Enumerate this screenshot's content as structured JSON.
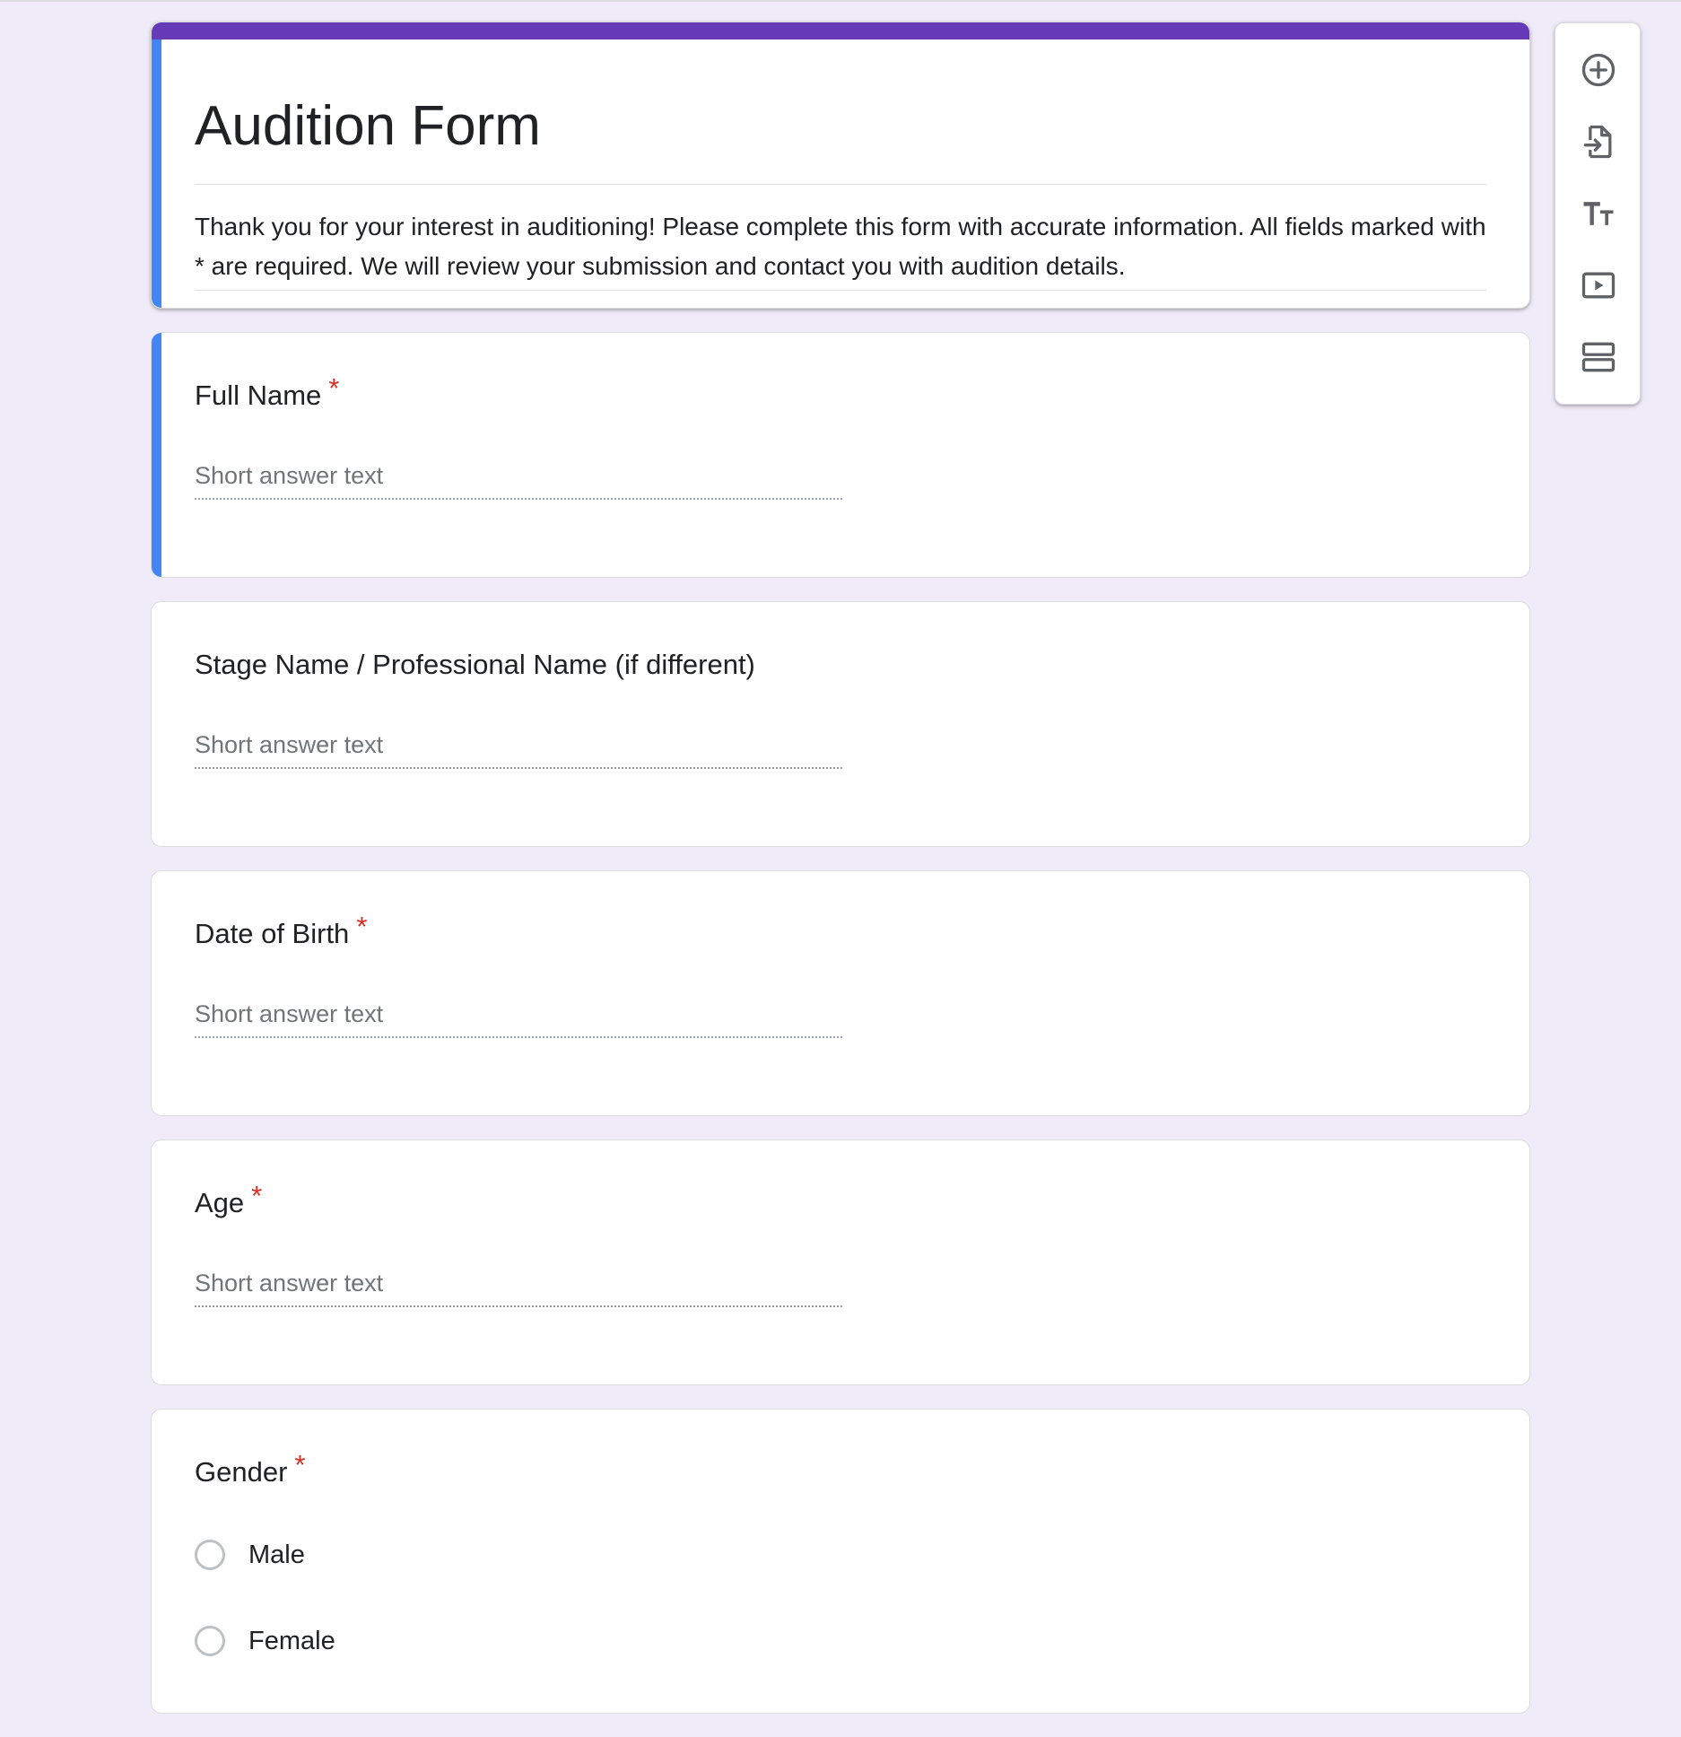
{
  "colors": {
    "page_background": "#f0ebf8",
    "accent_purple": "#673ab7",
    "active_blue": "#4285f4",
    "required_red": "#d93025"
  },
  "form": {
    "title": "Audition Form",
    "description": "Thank you for your interest in auditioning! Please complete this form with accurate information. All fields marked with * are required. We will review your submission and contact you with audition details."
  },
  "questions": [
    {
      "title": "Full Name",
      "required": "*",
      "placeholder": "Short answer text"
    },
    {
      "title": "Stage Name / Professional Name (if different)",
      "placeholder": "Short answer text"
    },
    {
      "title": "Date of Birth",
      "required": "*",
      "placeholder": "Short answer text"
    },
    {
      "title": "Age",
      "required": "*",
      "placeholder": "Short answer text"
    },
    {
      "title": "Gender",
      "required": "*",
      "options": [
        "Male",
        "Female"
      ]
    }
  ],
  "toolbar": {
    "items": [
      {
        "icon": "add-circle-icon"
      },
      {
        "icon": "import-questions-icon"
      },
      {
        "icon": "add-title-icon"
      },
      {
        "icon": "add-video-icon"
      },
      {
        "icon": "add-section-icon"
      }
    ]
  }
}
